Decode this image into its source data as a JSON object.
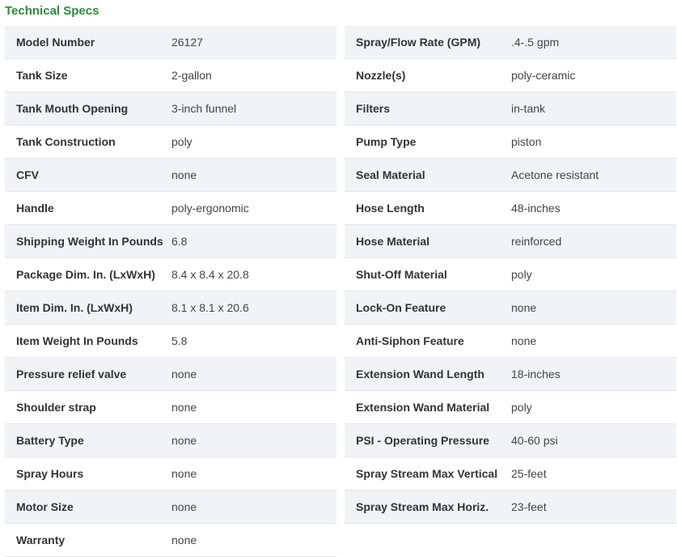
{
  "section_title": "Technical Specs",
  "colors": {
    "title_green": "#2e8b3a",
    "row_shade": "#f1f3f6",
    "row_border": "#e4e7eb"
  },
  "left_specs": [
    {
      "label": "Model Number",
      "value": "26127"
    },
    {
      "label": "Tank Size",
      "value": "2-gallon"
    },
    {
      "label": "Tank Mouth Opening",
      "value": "3-inch funnel"
    },
    {
      "label": "Tank Construction",
      "value": "poly"
    },
    {
      "label": "CFV",
      "value": "none"
    },
    {
      "label": "Handle",
      "value": "poly-ergonomic"
    },
    {
      "label": "Shipping Weight In Pounds",
      "value": "6.8"
    },
    {
      "label": "Package Dim. In. (LxWxH)",
      "value": "8.4 x 8.4 x 20.8"
    },
    {
      "label": "Item Dim. In. (LxWxH)",
      "value": "8.1 x 8.1 x 20.6"
    },
    {
      "label": "Item Weight In Pounds",
      "value": "5.8"
    },
    {
      "label": "Pressure relief valve",
      "value": "none"
    },
    {
      "label": "Shoulder strap",
      "value": "none"
    },
    {
      "label": "Battery Type",
      "value": "none"
    },
    {
      "label": "Spray Hours",
      "value": "none"
    },
    {
      "label": "Motor Size",
      "value": "none"
    },
    {
      "label": "Warranty",
      "value": "none"
    }
  ],
  "right_specs": [
    {
      "label": "Spray/Flow Rate (GPM)",
      "value": ".4-.5 gpm"
    },
    {
      "label": "Nozzle(s)",
      "value": "poly-ceramic"
    },
    {
      "label": "Filters",
      "value": "in-tank"
    },
    {
      "label": "Pump Type",
      "value": "piston"
    },
    {
      "label": "Seal Material",
      "value": "Acetone resistant"
    },
    {
      "label": "Hose Length",
      "value": "48-inches"
    },
    {
      "label": "Hose Material",
      "value": "reinforced"
    },
    {
      "label": "Shut-Off Material",
      "value": "poly"
    },
    {
      "label": "Lock-On Feature",
      "value": "none"
    },
    {
      "label": "Anti-Siphon Feature",
      "value": "none"
    },
    {
      "label": "Extension Wand Length",
      "value": "18-inches"
    },
    {
      "label": "Extension Wand Material",
      "value": "poly"
    },
    {
      "label": "PSI - Operating Pressure",
      "value": "40-60 psi"
    },
    {
      "label": "Spray Stream Max Vertical",
      "value": "25-feet"
    },
    {
      "label": "Spray Stream Max Horiz.",
      "value": "23-feet"
    }
  ]
}
